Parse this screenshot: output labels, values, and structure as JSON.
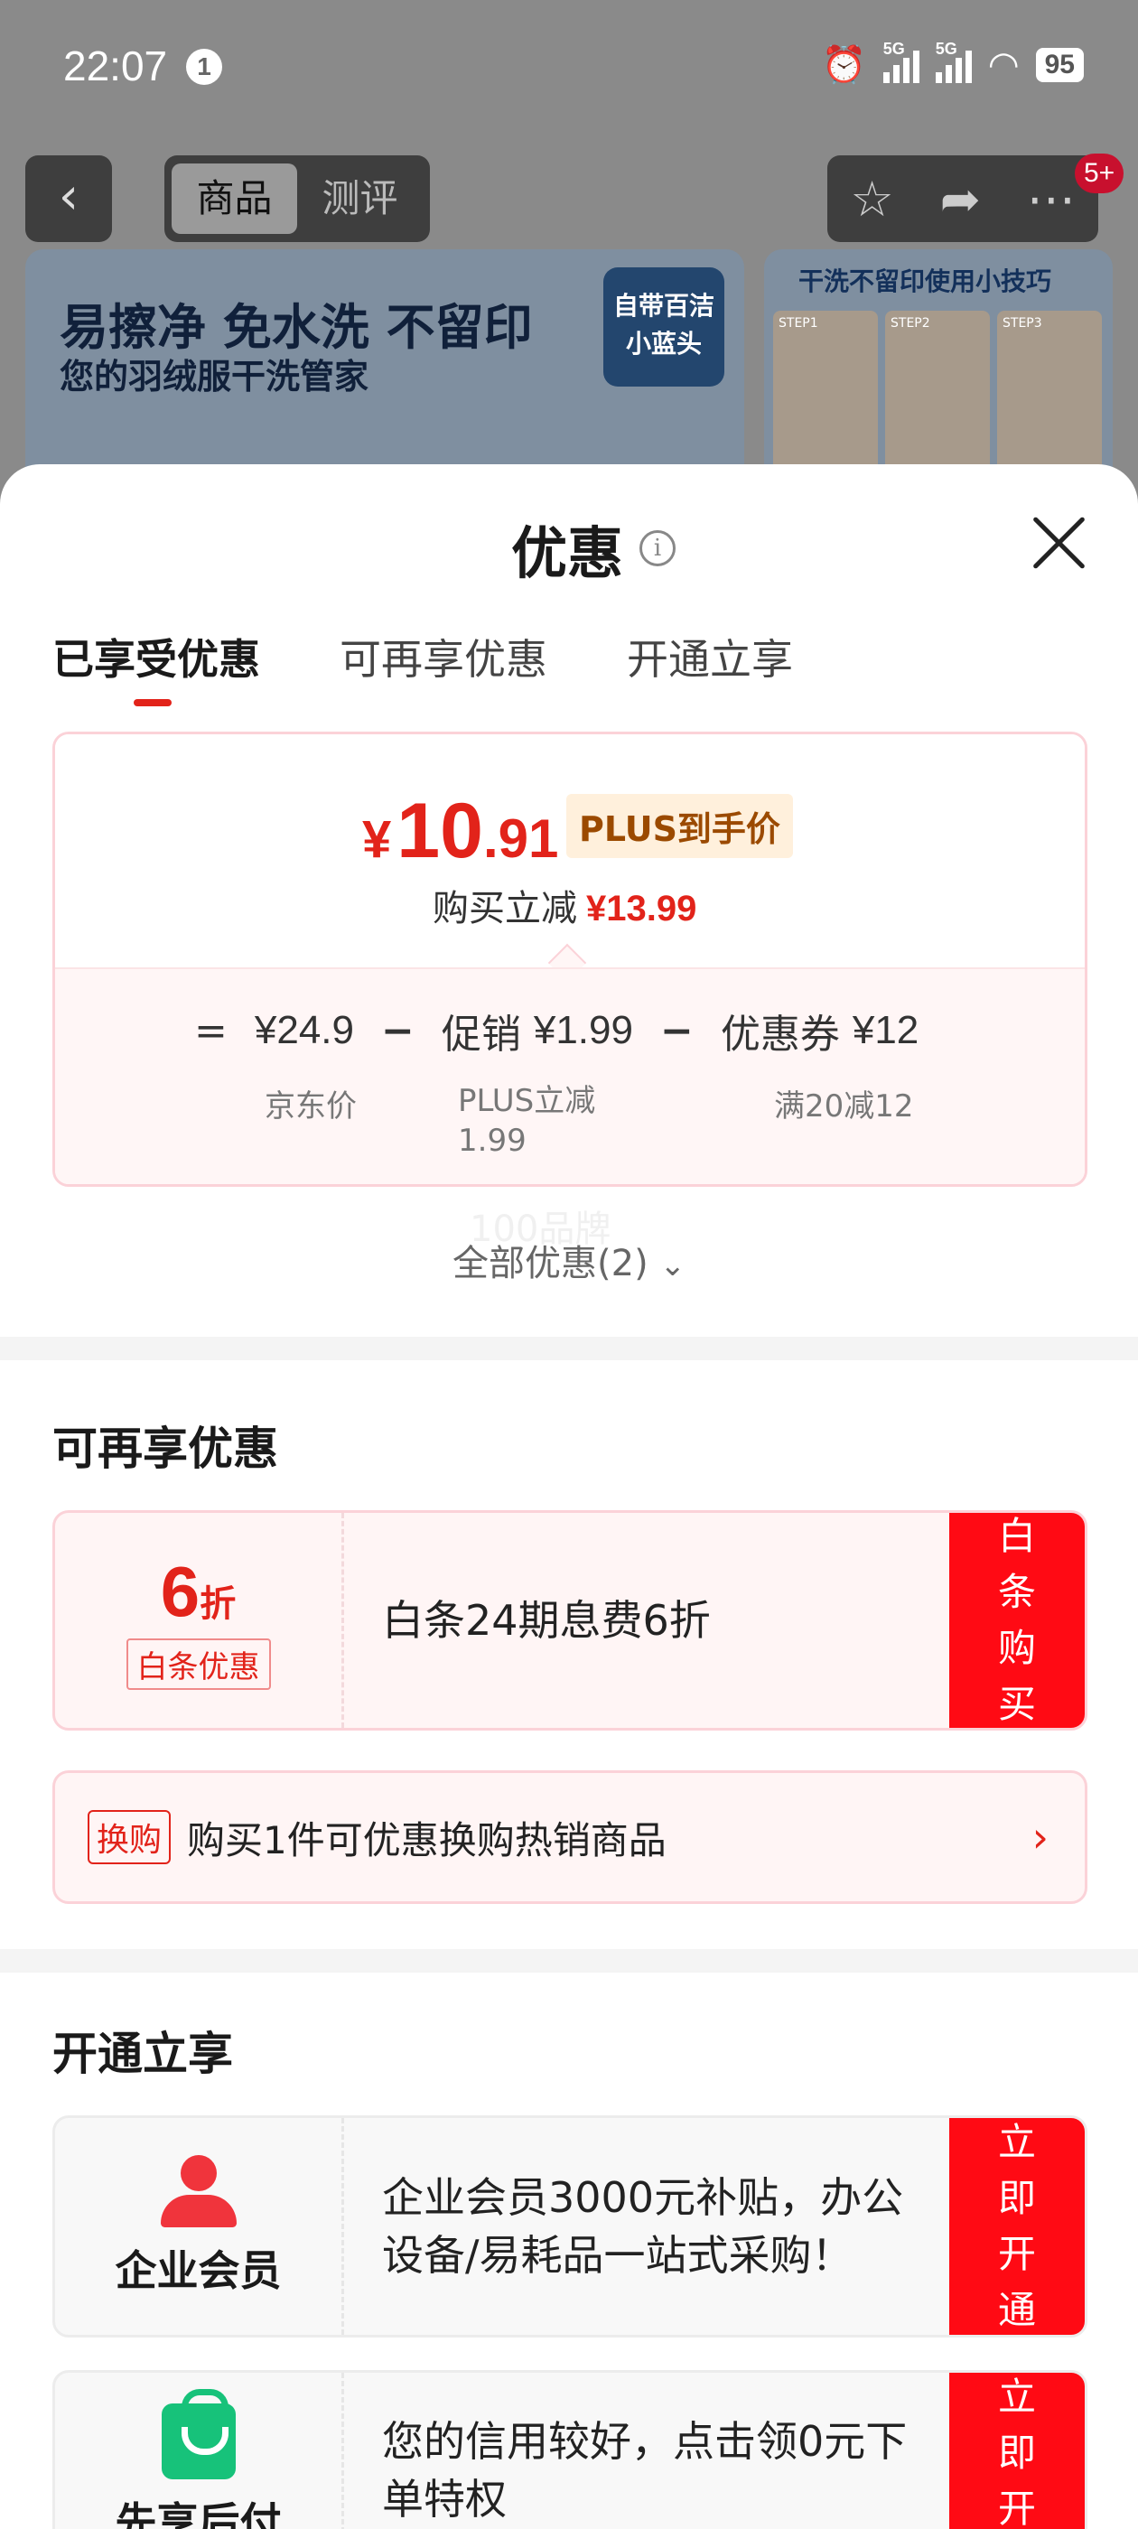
{
  "status_bar": {
    "time": "22:07",
    "notification_count": "1",
    "net_1": "5G",
    "net_2": "5G",
    "battery": "95"
  },
  "background_page": {
    "tabs": [
      {
        "label": "商品",
        "active": true
      },
      {
        "label": "测评",
        "active": false
      }
    ],
    "message_badge": "5+",
    "banner": {
      "headline": "易擦净 免水洗 不留印",
      "subline": "您的羽绒服干洗管家",
      "tag": "自带百洁小蓝头"
    },
    "side_banner": {
      "title": "干洗不留印使用小技巧",
      "steps": [
        "STEP1",
        "STEP2",
        "STEP3"
      ]
    }
  },
  "sheet": {
    "title": "优惠",
    "tabs": [
      {
        "label": "已享受优惠",
        "active": true
      },
      {
        "label": "可再享优惠",
        "active": false
      },
      {
        "label": "开通立享",
        "active": false
      }
    ],
    "price": {
      "currency": "¥",
      "integer": "10",
      "decimal": ".91",
      "tag": "PLUS到手价",
      "instant_discount_label": "购买立减",
      "instant_discount_value": "¥13.99",
      "eq": "=",
      "base_value": "¥24.9",
      "base_label": "京东价",
      "minus_1": "−",
      "promo_label": "促销",
      "promo_value": "¥1.99",
      "promo_note": "PLUS立减1.99",
      "minus_2": "−",
      "coupon_label": "优惠券",
      "coupon_value": "¥12",
      "coupon_note": "满20减12"
    },
    "watermark": "100品牌",
    "all_offers": "全部优惠(2)",
    "more_section": {
      "title": "可再享优惠",
      "baitiao": {
        "discount_number": "6",
        "discount_unit": "折",
        "discount_tag": "白条优惠",
        "description": "白条24期息费6折",
        "button": "白条购买"
      },
      "swap": {
        "tag": "换购",
        "text": "购买1件可优惠换购热销商品"
      }
    },
    "open_section": {
      "title": "开通立享",
      "enterprise": {
        "label": "企业会员",
        "description": "企业会员3000元补贴，办公设备/易耗品一站式采购！",
        "button": "立即开通"
      },
      "pay_later": {
        "label": "先享后付",
        "description": "您的信用较好，点击领0元下单特权",
        "button": "立即开通"
      }
    }
  },
  "colors": {
    "accent_red": "#e2231a",
    "button_red": "#ff0a14",
    "pay_later_green": "#17c27a"
  }
}
